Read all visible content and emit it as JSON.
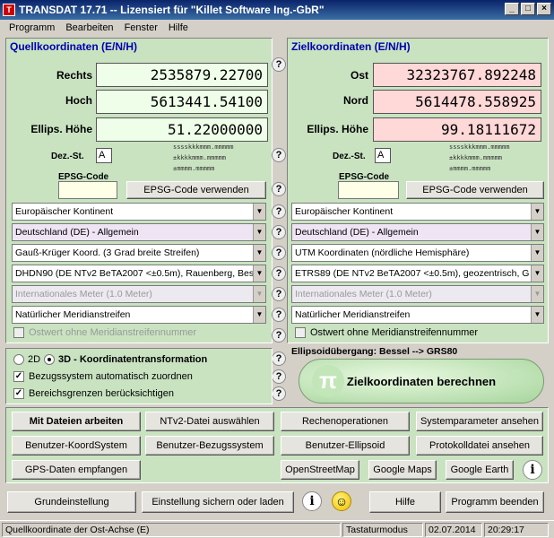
{
  "window": {
    "title": "TRANSDAT 17.71 -- Lizensiert für \"Killet Software Ing.-GbR\"",
    "app_icon": "T"
  },
  "menu": [
    "Programm",
    "Bearbeiten",
    "Fenster",
    "Hilfe"
  ],
  "source": {
    "title": "Quellkoordinaten (E/N/H)",
    "labels": [
      "Rechts",
      "Hoch",
      "Ellips. Höhe"
    ],
    "values": [
      "2535879.22700",
      "5613441.54100",
      "51.22000000"
    ],
    "dez_label": "Dez.-St.",
    "dez_value": "A",
    "format_lines": [
      "sssskkkmmm.mmmmm",
      "±kkkkmmm.mmmmm",
      "±mmmm.mmmmm"
    ],
    "epsg_label": "EPSG-Code",
    "epsg_button": "EPSG-Code verwenden",
    "combos": [
      "Europäischer Kontinent",
      "Deutschland (DE) - Allgemein",
      "Gauß-Krüger Koord. (3 Grad breite Streifen)",
      "DHDN90 (DE NTv2 BeTA2007 <±0.5m), Rauenberg, Bes",
      "Internationales Meter (1.0 Meter)",
      "Natürlicher Meridianstreifen"
    ],
    "checkbox": "Ostwert ohne Meridianstreifennummer"
  },
  "target": {
    "title": "Zielkoordinaten (E/N/H)",
    "labels": [
      "Ost",
      "Nord",
      "Ellips. Höhe"
    ],
    "values": [
      "32323767.892248",
      "5614478.558925",
      "99.18111672"
    ],
    "dez_label": "Dez.-St.",
    "dez_value": "A",
    "format_lines": [
      "sssskkkmmm.mmmmm",
      "±kkkkmmm.mmmmm",
      "±mmmm.mmmmm"
    ],
    "epsg_label": "EPSG-Code",
    "epsg_button": "EPSG-Code verwenden",
    "combos": [
      "Europäischer Kontinent",
      "Deutschland (DE) - Allgemein",
      "UTM Koordinaten (nördliche Hemisphäre)",
      "ETRS89 (DE NTv2 BeTA2007 <±0.5m), geozentrisch, G",
      "Internationales Meter (1.0 Meter)",
      "Natürlicher Meridianstreifen"
    ],
    "checkbox": "Ostwert ohne Meridianstreifennummer"
  },
  "options": {
    "radio_2d": "2D",
    "radio_3d": "3D - Koordinatentransformation",
    "check_bezug": "Bezugssystem automatisch zuordnen",
    "check_bereich": "Bereichsgrenzen berücksichtigen"
  },
  "ellipsoid_transition": "Ellipsoidübergang: Bessel --> GRS80",
  "calc_button": "Zielkoordinaten berechnen",
  "calc_icon": "π",
  "help_glyph": "?",
  "info_glyph": "i",
  "smiley_glyph": "☺",
  "buttons": {
    "row1": [
      "Mit Dateien arbeiten",
      "NTv2-Datei auswählen",
      "Rechenoperationen",
      "Systemparameter ansehen"
    ],
    "row2": [
      "Benutzer-KoordSystem",
      "Benutzer-Bezugssystem",
      "Benutzer-Ellipsoid",
      "Protokolldatei ansehen"
    ],
    "row3": [
      "GPS-Daten empfangen",
      "OpenStreetMap",
      "Google Maps",
      "Google Earth"
    ],
    "row4": [
      "Grundeinstellung",
      "Einstellung sichern oder laden",
      "Hilfe",
      "Programm beenden"
    ]
  },
  "status": {
    "message": "Quellkoordinate der Ost-Achse (E)",
    "mode": "Tastaturmodus",
    "date": "02.07.2014",
    "time": "20:29:17"
  }
}
